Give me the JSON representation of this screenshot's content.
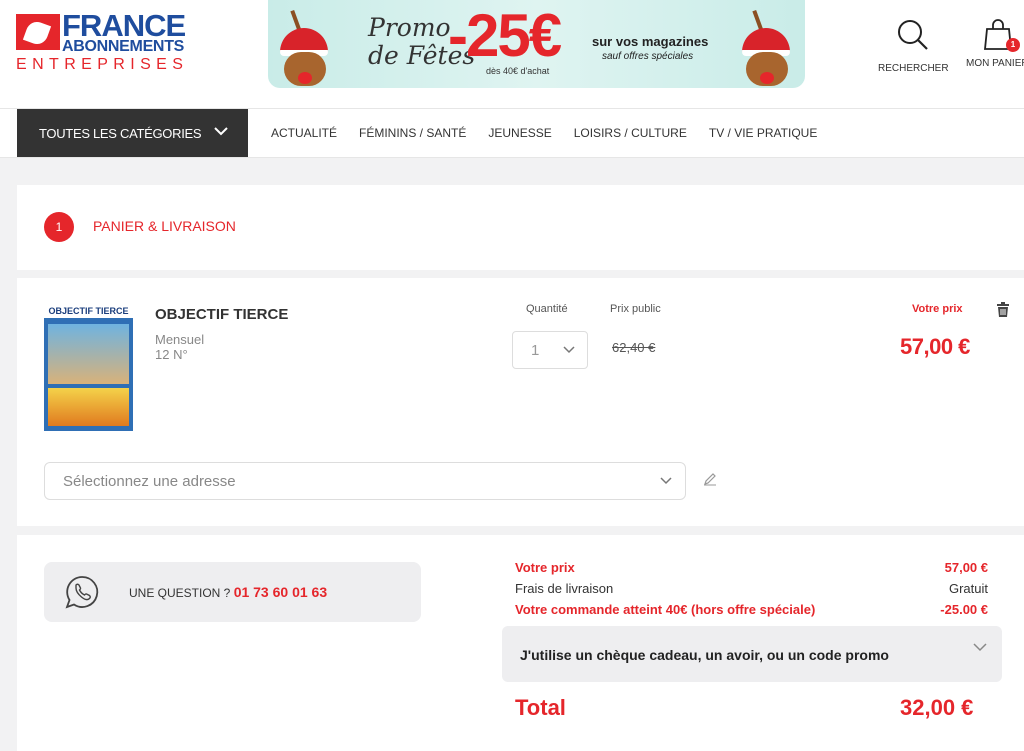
{
  "logo": {
    "line1": "FRANCE",
    "line2": "ABONNEMENTS",
    "line3": "ENTREPRISES"
  },
  "banner": {
    "promo": "Promo",
    "promo2": "de Fêtes",
    "discount": "-25€",
    "condition": "dès 40€ d'achat",
    "right1": "sur vos magazines",
    "right2": "sauf offres spéciales"
  },
  "header": {
    "search_label": "RECHERCHER",
    "cart_label": "MON PANIER",
    "cart_count": "1"
  },
  "nav": {
    "all_categories": "TOUTES LES CATÉGORIES",
    "links": [
      "ACTUALITÉ",
      "FÉMININS / SANTÉ",
      "JEUNESSE",
      "LOISIRS / CULTURE",
      "TV / VIE PRATIQUE"
    ]
  },
  "step": {
    "number": "1",
    "label": "PANIER & LIVRAISON"
  },
  "product": {
    "cover_title": "OBJECTIF TIERCE",
    "name": "OBJECTIF TIERCE",
    "frequency": "Mensuel",
    "issues": "12 N°",
    "quantity_label": "Quantité",
    "quantity_value": "1",
    "public_price_label": "Prix public",
    "public_price": "62,40 €",
    "your_price_label": "Votre prix",
    "your_price": "57,00 €"
  },
  "address": {
    "placeholder": "Sélectionnez une adresse"
  },
  "question": {
    "label": "UNE QUESTION ? ",
    "phone": "01 73 60 01 63"
  },
  "summary": {
    "rows": [
      {
        "label": "Votre prix",
        "value": "57,00 €"
      },
      {
        "label": "Frais de livraison",
        "value": "Gratuit"
      },
      {
        "label": "Votre commande atteint 40€ (hors offre spéciale)",
        "value": "-25.00 €"
      }
    ],
    "gift_label": "J'utilise un chèque cadeau, un avoir, ou un code promo",
    "total_label": "Total",
    "total_value": "32,00 €"
  },
  "colors": {
    "brand_red": "#e5262b",
    "brand_blue": "#1f4d9e",
    "dark": "#333333"
  }
}
